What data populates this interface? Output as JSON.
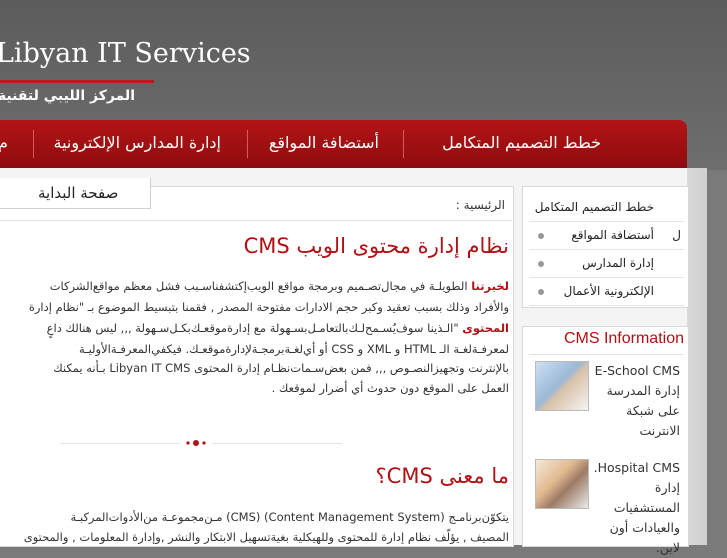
{
  "header": {
    "brand_title": "Libyan IT Services",
    "brand_arabic": "المركز الليبي لتقنية المعلومات"
  },
  "nav": {
    "items": [
      {
        "label": "خطط التصميم المتكامل"
      },
      {
        "label": "أستضافة المواقع"
      },
      {
        "label": "إدارة المدارس الإلكترونية"
      }
    ],
    "partial_label": "م"
  },
  "tabs": {
    "home_label": "صفحة البداية"
  },
  "breadcrumb": "الرئيسية :",
  "main": {
    "title": "نظام إدارة محتوى الويب CMS",
    "intro_lines": [
      {
        "bold": "لخبرتنا",
        "text": "   الطويلـة في مجال‌تصـميم وبرمجة مواقع الويب‌إكتشفناسـبب فشل معظم مواقع‌الشركات"
      },
      {
        "bold": "",
        "text": "والأفراد وذلك بسبب تعقيد وكبر حجم الادارات مفتوحة المصدر , فقمنا بتبسيط الموضوع بـ \"نظام إدارة"
      },
      {
        "bold": "المحتوى",
        "text": "   \"الـذينا سوف‌يُسـمح‌لـك‌بالتعامـل‌بسـهولة مع إدارة‌موقعـك‌بكـل‌سـهولة ,,, ليس هنالك داعٍ"
      },
      {
        "bold": "",
        "text": "لمعرفـةلغـة الـ HTML  و XML  و  CSS    أو أي‌لغـةبرمجـة‌لإدارةموقعـك. فيكفي‌المعرفـة‌الأوليـة"
      },
      {
        "bold": "",
        "text": "بالإنترنت وتجهيزالنصـوص ,,, فمن بعض‌سـمات‌نظـام إدارة المحتوى  Libyan IT CMS  بـأنه يمكنك"
      },
      {
        "bold": "",
        "text": "العمل على الموقع دون حدوث أي أضرار لموقعك ."
      }
    ],
    "section_title": "ما معنى CMS؟",
    "section_lines": [
      {
        "text": "يتكوّن‌برنامـج (Content Management System)  (CMS)  مـن‌مجموعـة من‌الأدوات‌المركبـة"
      },
      {
        "text": "المصيف , يؤلّف نظام إدارة للمحتوى وللهيكلية بغية‌تسهيل الابتكار والنشر ,وإدارة المعلومات , والمحتوى"
      }
    ]
  },
  "sidebar": {
    "items": [
      {
        "label": "خطط التصميم المتكامل"
      },
      {
        "label": "أستضافة المواقع"
      },
      {
        "label": "إدارة المدارس"
      },
      {
        "label": "الإلكترونية الأعمال"
      }
    ],
    "partial_char": "ل"
  },
  "cms_info": {
    "title": "CMS Information",
    "entries": [
      {
        "text": "E-School CMS إدارة المدرسة على شبكة الانترنت"
      },
      {
        "text": "Hospital CMS. إدارة المستشفيات والعيادات أون لاين."
      }
    ]
  }
}
